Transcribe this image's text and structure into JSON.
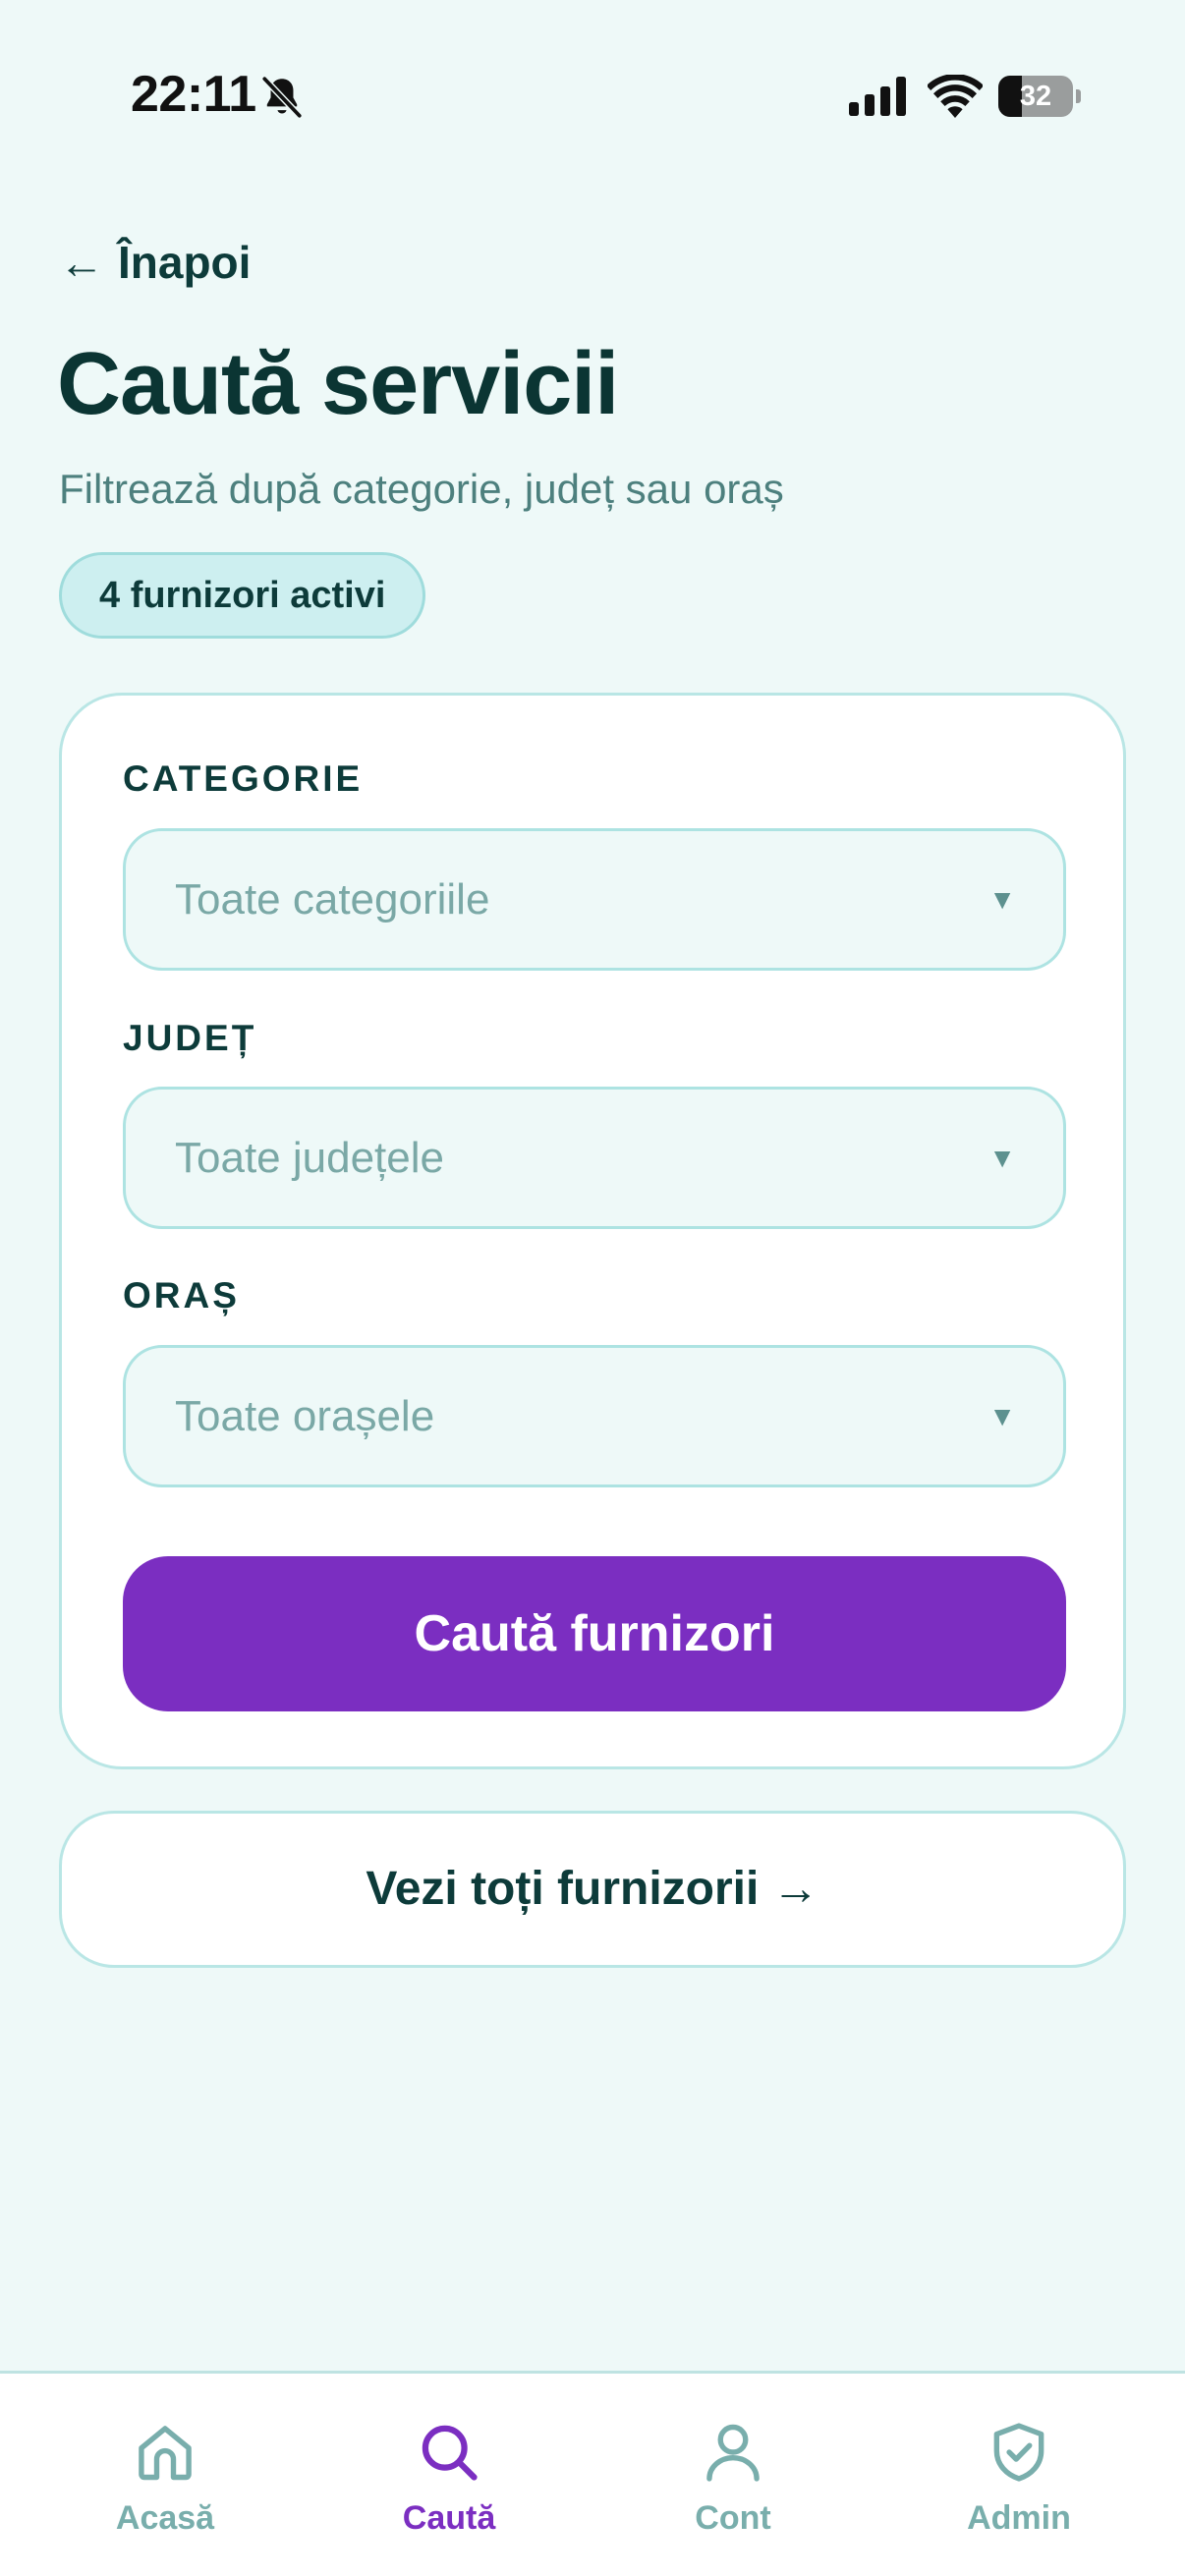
{
  "status_bar": {
    "time": "22:11",
    "battery_level": "32",
    "icons": [
      "bell-slash-icon",
      "signal-icon",
      "wifi-icon",
      "battery-icon"
    ]
  },
  "header": {
    "back_label": "Înapoi",
    "back_arrow": "←",
    "title": "Caută servicii",
    "subtitle": "Filtrează după categorie, județ sau oraș",
    "badge": "4 furnizori activi"
  },
  "filters": {
    "category": {
      "label": "CATEGORIE",
      "value": "Toate categoriile"
    },
    "county": {
      "label": "JUDEȚ",
      "value": "Toate județele"
    },
    "city": {
      "label": "ORAȘ",
      "value": "Toate orașele"
    },
    "caret": "▼"
  },
  "actions": {
    "search": "Caută furnizori",
    "see_all": "Vezi toți furnizorii →"
  },
  "nav": {
    "items": [
      {
        "label": "Acasă",
        "icon": "home-icon"
      },
      {
        "label": "Caută",
        "icon": "search-icon",
        "active": true
      },
      {
        "label": "Cont",
        "icon": "user-icon"
      },
      {
        "label": "Admin",
        "icon": "shield-check-icon"
      }
    ]
  },
  "colors": {
    "background": "#eef9f8",
    "primary_text": "#0d3b3a",
    "accent": "#7b2ec1",
    "badge_bg": "#cdeff0",
    "border": "#b9e6e5",
    "muted": "#79aeac"
  }
}
